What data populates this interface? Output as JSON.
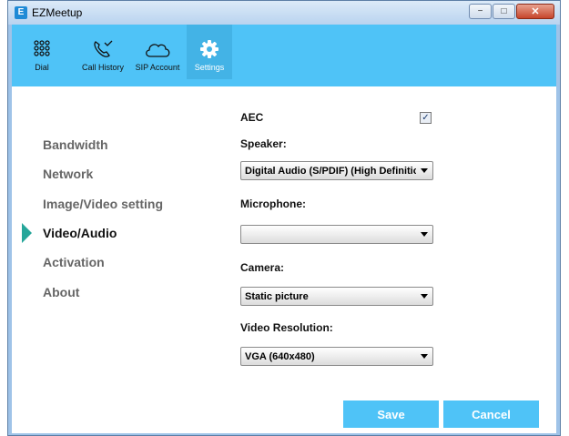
{
  "window": {
    "title": "EZMeetup",
    "app_icon": "EZ-logo",
    "controls": {
      "minimize": "−",
      "maximize": "□",
      "close": "✕"
    }
  },
  "toolbar": {
    "items": [
      {
        "label": "Dial",
        "icon": "dialpad-icon"
      },
      {
        "label": "Call History",
        "icon": "phone-history-icon"
      },
      {
        "label": "SIP Account",
        "icon": "cloud-icon"
      },
      {
        "label": "Settings",
        "icon": "gear-icon",
        "active": true
      }
    ]
  },
  "sidebar": {
    "items": [
      {
        "label": "Bandwidth"
      },
      {
        "label": "Network"
      },
      {
        "label": "Image/Video setting"
      },
      {
        "label": "Video/Audio",
        "active": true
      },
      {
        "label": "Activation"
      },
      {
        "label": "About"
      }
    ]
  },
  "settings": {
    "aec_label": "AEC",
    "aec_checked": true,
    "aec_check_glyph": "✓",
    "speaker_label": "Speaker:",
    "speaker_value": "Digital Audio (S/PDIF) (High Definition Audio Device)",
    "microphone_label": "Microphone:",
    "microphone_value": "",
    "camera_label": "Camera:",
    "camera_value": "Static picture",
    "resolution_label": "Video Resolution:",
    "resolution_value": "VGA (640x480)"
  },
  "actions": {
    "save": "Save",
    "cancel": "Cancel"
  },
  "colors": {
    "accent": "#4fc3f7",
    "sidebar_marker": "#26a69a"
  }
}
